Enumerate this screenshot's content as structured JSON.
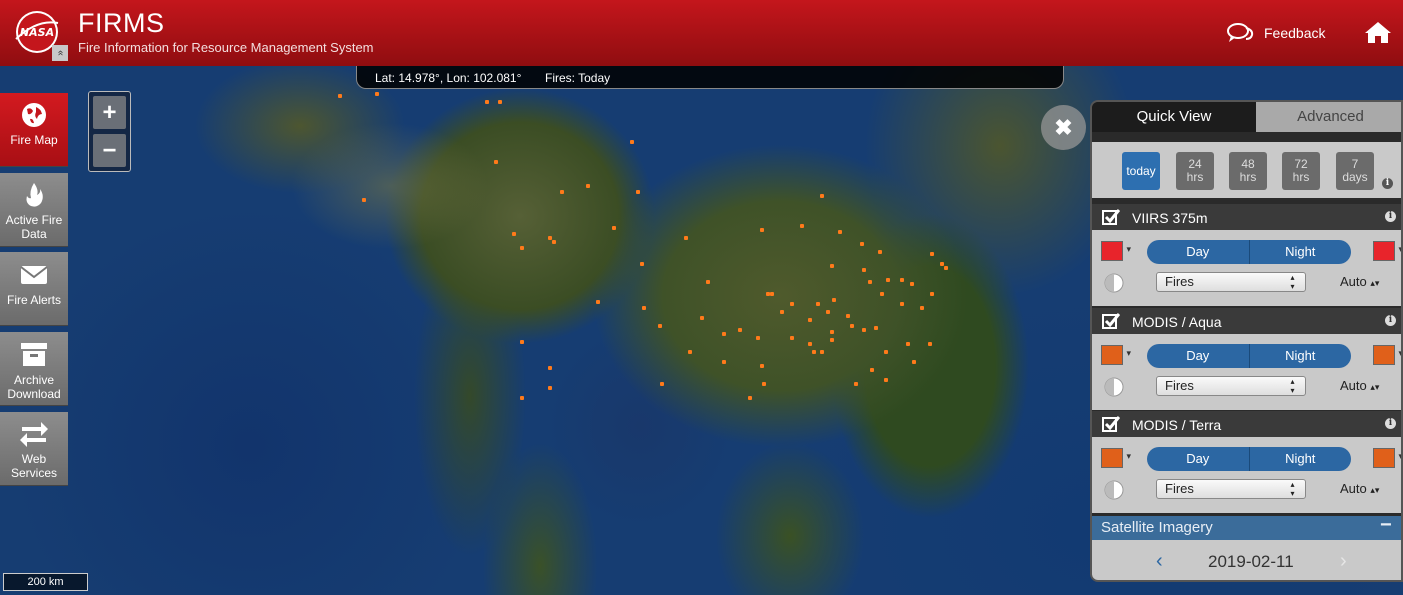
{
  "header": {
    "logo_text": "NASA",
    "title": "FIRMS",
    "subtitle": "Fire Information for Resource Management System",
    "feedback_label": "Feedback"
  },
  "map": {
    "coordinates": "Lat: 14.978°, Lon: 102.081°",
    "fires_label": "Fires: Today",
    "scale_label": "200 km",
    "zoom_in": "+",
    "zoom_out": "−",
    "fire_color": "#ff7a1a"
  },
  "nav": {
    "collapse": "«",
    "items": [
      {
        "label": "Fire Map",
        "icon": "globe-icon",
        "active": true
      },
      {
        "label": "Active Fire Data",
        "icon": "flame-icon"
      },
      {
        "label": "Fire Alerts",
        "icon": "envelope-icon"
      },
      {
        "label": "Archive Download",
        "icon": "archive-box-icon"
      },
      {
        "label": "Web Services",
        "icon": "swap-arrows-icon"
      }
    ]
  },
  "panel": {
    "close": "✖",
    "tabs": {
      "quick": "Quick View",
      "advanced": "Advanced"
    },
    "time_filters": [
      {
        "line1": "today",
        "line2": "",
        "active": true
      },
      {
        "line1": "24",
        "line2": "hrs"
      },
      {
        "line1": "48",
        "line2": "hrs"
      },
      {
        "line1": "72",
        "line2": "hrs"
      },
      {
        "line1": "7",
        "line2": "days"
      }
    ],
    "info": "i",
    "layers": [
      {
        "name": "VIIRS 375m",
        "color": "#e8242b",
        "day": "Day",
        "night": "Night",
        "select": "Fires",
        "auto": "Auto"
      },
      {
        "name": "MODIS / Aqua",
        "color": "#e0601a",
        "day": "Day",
        "night": "Night",
        "select": "Fires",
        "auto": "Auto"
      },
      {
        "name": "MODIS / Terra",
        "color": "#e0601a",
        "day": "Day",
        "night": "Night",
        "select": "Fires",
        "auto": "Auto"
      }
    ],
    "satellite": {
      "title": "Satellite Imagery",
      "collapse": "−",
      "date": "2019-02-11",
      "prev": "‹",
      "next": "›"
    }
  }
}
